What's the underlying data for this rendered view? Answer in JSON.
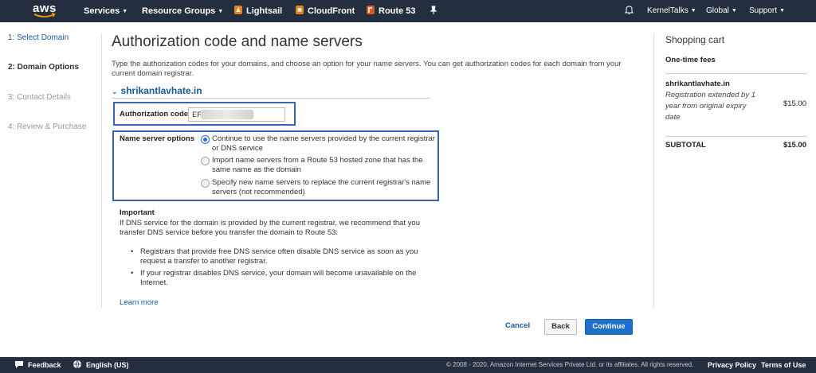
{
  "nav": {
    "logo": "aws",
    "services": "Services",
    "resource_groups": "Resource Groups",
    "lightsail": "Lightsail",
    "cloudfront": "CloudFront",
    "route53": "Route 53",
    "account": "KernelTalks",
    "region": "Global",
    "support": "Support"
  },
  "steps": [
    {
      "label": "1: Select Domain",
      "state": "link"
    },
    {
      "label": "2: Domain Options",
      "state": "current"
    },
    {
      "label": "3: Contact Details",
      "state": "disabled"
    },
    {
      "label": "4: Review & Purchase",
      "state": "disabled"
    }
  ],
  "main": {
    "title": "Authorization code and name servers",
    "intro": "Type the authorization codes for your domains, and choose an option for your name servers. You can get authorization codes for each domain from your current domain registrar.",
    "domain": "shrikantlavhate.in",
    "auth_label": "Authorization code",
    "auth_value": "EF2",
    "ns_label": "Name server options",
    "ns_options": [
      {
        "label": "Continue to use the name servers provided by the current registrar or DNS service",
        "selected": true
      },
      {
        "label": "Import name servers from a Route 53 hosted zone that has the same name as the domain",
        "selected": false
      },
      {
        "label": "Specify new name servers to replace the current registrar's name servers (not recommended)",
        "selected": false
      }
    ],
    "important_title": "Important",
    "important_text": "If DNS service for the domain is provided by the current registrar, we recommend that you transfer DNS service before you transfer the domain to Route 53:",
    "bullets": [
      "Registrars that provide free DNS service often disable DNS service as soon as you request a transfer to another registrar.",
      "If your registrar disables DNS service, your domain will become unavailable on the Internet."
    ],
    "learn_more": "Learn more"
  },
  "actions": {
    "cancel": "Cancel",
    "back": "Back",
    "continue": "Continue"
  },
  "cart": {
    "title": "Shopping cart",
    "section": "One-time fees",
    "domain": "shrikantlavhate.in",
    "description": "Registration extended by 1 year from original expiry date",
    "price": "$15.00",
    "subtotal_label": "SUBTOTAL",
    "subtotal_value": "$15.00"
  },
  "footer": {
    "feedback": "Feedback",
    "language": "English (US)",
    "copyright": "© 2008 - 2020, Amazon Internet Services Private Ltd. or its affiliates. All rights reserved.",
    "privacy": "Privacy Policy",
    "terms": "Terms of Use"
  },
  "colors": {
    "nav_bg": "#232f3e",
    "link": "#1a5a9c",
    "highlight_border": "#3a64b4",
    "primary_button": "#1f6fcd"
  }
}
